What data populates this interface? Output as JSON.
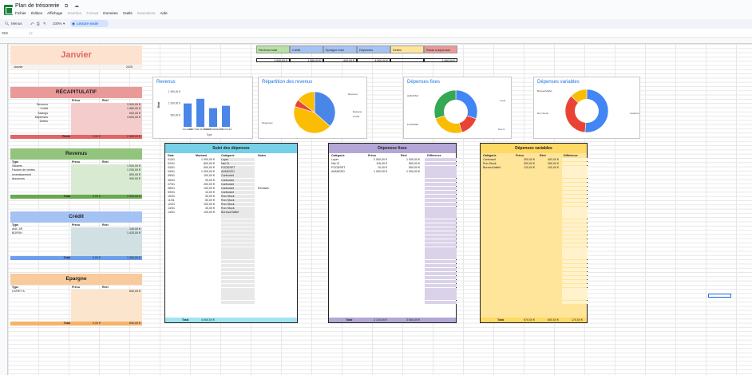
{
  "app": {
    "doc_title": "Plan de trésorerie",
    "menu": [
      "Fichier",
      "Édition",
      "Affichage",
      "Insertion",
      "Format",
      "Données",
      "Outils",
      "Extensions",
      "Aide"
    ],
    "toolbar": {
      "menus": "Menus",
      "zoom": "100%",
      "readonly": "Lecture seule"
    },
    "namebox": "S52",
    "colors": {
      "accent": "#1a73e8",
      "brand": "#188038"
    }
  },
  "header": {
    "month_title": "Janvier",
    "month_value": "Janvier",
    "year_value": "2025"
  },
  "summary_bar": {
    "labels": [
      "Revenus total",
      "Crédit",
      "Epargne total",
      "Dépenses",
      "Dettes",
      "Reste à dépenser"
    ],
    "values": [
      "3 900,00 €",
      "1 560,00 €",
      "600,00 €",
      "4 600,00 €",
      "",
      "2 460,00 €"
    ],
    "colors": [
      "#b7e1a1",
      "#a4c2f4",
      "#a4c2f4",
      "#a4c2f4",
      "#ffe599",
      "#ea9999"
    ]
  },
  "recap": {
    "title": "RÉCAPITULATIF",
    "col_prev": "Prévu",
    "col_real": "Réel",
    "rows": [
      {
        "label": "Revenus",
        "real": "3 900,00 €"
      },
      {
        "label": "Crédit",
        "real": "1 560,00 €"
      },
      {
        "label": "Savings",
        "real": "600,00 €"
      },
      {
        "label": "Dépenses",
        "real": "4 600,00 €"
      },
      {
        "label": "Dettes",
        "real": ""
      }
    ],
    "total_label": "Reste",
    "total_prev": "0,00 €",
    "total_real": "2 460,00 €"
  },
  "revenus": {
    "title": "Revenus",
    "col_type": "Type",
    "col_prev": "Prévu",
    "col_real": "Réel",
    "rows": [
      {
        "type": "Salaires",
        "real": "1 000,00 €"
      },
      {
        "type": "Facture de ventes",
        "real": "1 200,00 €"
      },
      {
        "type": "Investissement",
        "real": "800,00 €"
      },
      {
        "type": "Annonces",
        "real": "900,00 €"
      }
    ],
    "total_label": "Total",
    "total_prev": "0,00 €",
    "total_real": "3 900,00 €"
  },
  "credit": {
    "title": "Crédit",
    "col_type": "Type",
    "col_prev": "Prévu",
    "col_real": "Réel",
    "rows": [
      {
        "type": "ANC 4R",
        "real": "140,00 €"
      },
      {
        "type": "BORSH",
        "real": "1 420,00 €"
      }
    ],
    "total_label": "Total",
    "total_prev": "0,00 €",
    "total_real": "1 560,00 €"
  },
  "epargne": {
    "title": "Epargne",
    "col_type": "Type",
    "col_prev": "Prévu",
    "col_real": "Réel",
    "rows": [
      {
        "type": "LIVRET A",
        "real": "600,00 €"
      }
    ],
    "total_label": "Total",
    "total_prev": "0,00 €",
    "total_real": "600,00 €"
  },
  "suivi": {
    "title": "Suivi des dépenses",
    "cols": [
      "Date",
      "Montant",
      "Catégorie",
      "Notes"
    ],
    "rows": [
      [
        "01/01",
        "1 000,00 €",
        "Loyer",
        ""
      ],
      [
        "02/01",
        "800,00 €",
        "Net Ct",
        ""
      ],
      [
        "03/01",
        "500,00 €",
        "FOODSET",
        ""
      ],
      [
        "04/01",
        "1 000,00 €",
        "AVANSSO",
        ""
      ],
      [
        "05/01",
        "100,00 €",
        "Carburant",
        ""
      ],
      [
        "06/01",
        "90,00 €",
        "Carburant",
        ""
      ],
      [
        "07/01",
        "200,00 €",
        "Carburant",
        ""
      ],
      [
        "08/01",
        "100,00 €",
        "Carburant",
        "Remises"
      ],
      [
        "09/01",
        "10,00 €",
        "Carburant",
        ""
      ],
      [
        "10/01",
        "30,00 €",
        "Run Stock",
        ""
      ],
      [
        "11/01",
        "50,00 €",
        "Run Stock",
        ""
      ],
      [
        "12/01",
        "100,00 €",
        "Run Stock",
        ""
      ],
      [
        "13/01",
        "30,00 €",
        "Run Stock",
        ""
      ],
      [
        "14/01",
        "100,00 €",
        "Bureau/Vaillet",
        ""
      ]
    ],
    "total_label": "Total",
    "total_value": "4 600,00 €"
  },
  "fixes": {
    "title": "Dépenses fixes",
    "cols": [
      "Catégorie",
      "Prévu",
      "Réel",
      "Différence"
    ],
    "rows": [
      [
        "Loyer",
        "2 000,00 €",
        "1 000,00 €",
        ""
      ],
      [
        "Net Ct",
        "115,00 €",
        "800,00 €",
        ""
      ],
      [
        "FOODSET",
        "10,00 €",
        "500,00 €",
        ""
      ],
      [
        "AVANSSO",
        "1 000,00 €",
        "1 000,00 €",
        ""
      ]
    ],
    "total_label": "Total",
    "total_prev": "2 120,00 €",
    "total_real": "3 800,00 €"
  },
  "variables": {
    "title": "Dépenses variables",
    "cols": [
      "Catégorie",
      "Prévu",
      "Réel",
      "Différence"
    ],
    "rows": [
      [
        "Carburant",
        "300,00 €",
        "400,00 €",
        ""
      ],
      [
        "Run Stock",
        "300,00 €",
        "280,00 €",
        ""
      ],
      [
        "Bureau/Vaillet",
        "120,00 €",
        "100,00 €",
        ""
      ]
    ],
    "total_label": "Total",
    "total_prev": "970,00 €",
    "total_real": "800,00 €",
    "total_diff": "170,00 €"
  },
  "charts": {
    "revenus": {
      "title": "Revenus",
      "ylabel": "Réel",
      "xlabel": "Type",
      "ticks": [
        "1 500,00 €",
        "1 000,00 €",
        "500,00 €"
      ],
      "categories": [
        "SALAIRES",
        "FACTURE DE VENTES",
        "INVESTISSEMENTS",
        "ANNONCES"
      ],
      "values": [
        1000,
        1200,
        800,
        900
      ],
      "color": "#4a86e8"
    },
    "repartition": {
      "title": "Répartition des revenus",
      "labels": [
        "Revenus",
        "Dépenses",
        "Epargne",
        "Crédit"
      ],
      "slices": [
        {
          "v": 3900,
          "c": "#4a86e8"
        },
        {
          "v": 4600,
          "c": "#fbbc04"
        },
        {
          "v": 600,
          "c": "#ea4335"
        },
        {
          "v": 1560,
          "c": "#fbbc04"
        }
      ]
    },
    "fixes": {
      "title": "Dépenses fixes",
      "labels": [
        "Loyer",
        "FOODSET",
        "Net Ct",
        "AVANSSO"
      ],
      "slices": [
        {
          "v": 1000,
          "c": "#4285f4"
        },
        {
          "v": 500,
          "c": "#ea4335"
        },
        {
          "v": 800,
          "c": "#fbbc04"
        },
        {
          "v": 1000,
          "c": "#34a853"
        }
      ]
    },
    "variables": {
      "title": "Dépenses variables",
      "labels": [
        "Run Stock",
        "Carburant",
        "Bureau/Vaillet"
      ],
      "slices": [
        {
          "v": 400,
          "c": "#4285f4"
        },
        {
          "v": 280,
          "c": "#ea4335"
        },
        {
          "v": 100,
          "c": "#fbbc04"
        }
      ]
    }
  }
}
